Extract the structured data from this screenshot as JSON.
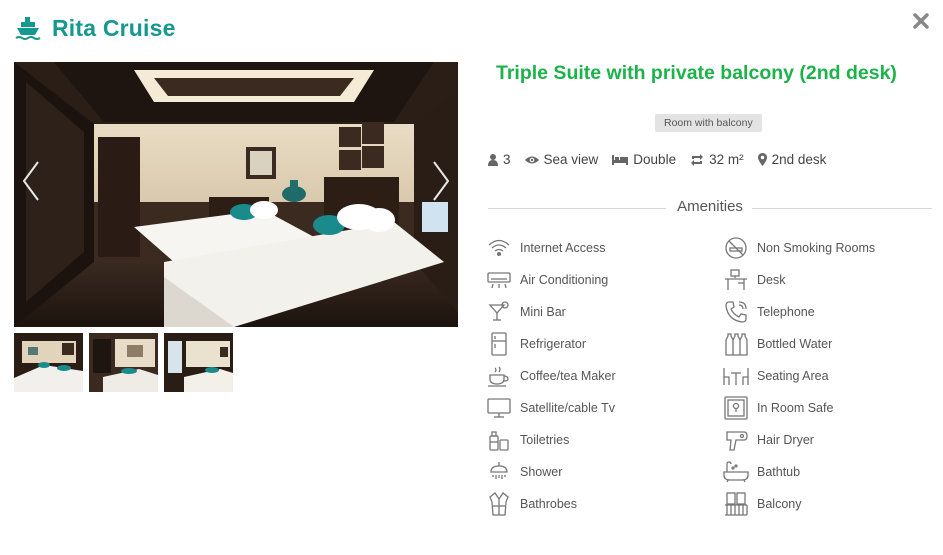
{
  "brand": {
    "name": "Rita Cruise",
    "icon": "ship-icon",
    "color": "#14988f"
  },
  "close_icon": "close-icon",
  "gallery": {
    "prev_icon": "chevron-left-icon",
    "next_icon": "chevron-right-icon",
    "thumbnail_count": 3
  },
  "room": {
    "title": "Triple Suite with private balcony (2nd desk)",
    "tag": "Room with balcony",
    "title_color": "#1cb34b"
  },
  "specs": [
    {
      "icon": "user-icon",
      "label": "3"
    },
    {
      "icon": "eye-icon",
      "label": "Sea view"
    },
    {
      "icon": "bed-icon",
      "label": "Double"
    },
    {
      "icon": "area-icon",
      "label": "32 m²"
    },
    {
      "icon": "map-marker-icon",
      "label": "2nd desk"
    }
  ],
  "amenities": {
    "heading": "Amenities",
    "left": [
      {
        "icon": "wifi-icon",
        "label": "Internet Access"
      },
      {
        "icon": "air-conditioning-icon",
        "label": "Air Conditioning"
      },
      {
        "icon": "cocktail-icon",
        "label": "Mini Bar"
      },
      {
        "icon": "refrigerator-icon",
        "label": "Refrigerator"
      },
      {
        "icon": "coffee-cup-icon",
        "label": "Coffee/tea Maker"
      },
      {
        "icon": "tv-icon",
        "label": "Satellite/cable Tv"
      },
      {
        "icon": "toiletries-icon",
        "label": "Toiletries"
      },
      {
        "icon": "shower-icon",
        "label": "Shower"
      },
      {
        "icon": "bathrobe-icon",
        "label": "Bathrobes"
      }
    ],
    "right": [
      {
        "icon": "no-smoking-icon",
        "label": "Non Smoking Rooms"
      },
      {
        "icon": "desk-icon",
        "label": "Desk"
      },
      {
        "icon": "telephone-icon",
        "label": "Telephone"
      },
      {
        "icon": "bottled-water-icon",
        "label": "Bottled Water"
      },
      {
        "icon": "seating-area-icon",
        "label": "Seating Area"
      },
      {
        "icon": "safe-icon",
        "label": "In Room Safe"
      },
      {
        "icon": "hair-dryer-icon",
        "label": "Hair Dryer"
      },
      {
        "icon": "bathtub-icon",
        "label": "Bathtub"
      },
      {
        "icon": "balcony-icon",
        "label": "Balcony"
      }
    ]
  }
}
